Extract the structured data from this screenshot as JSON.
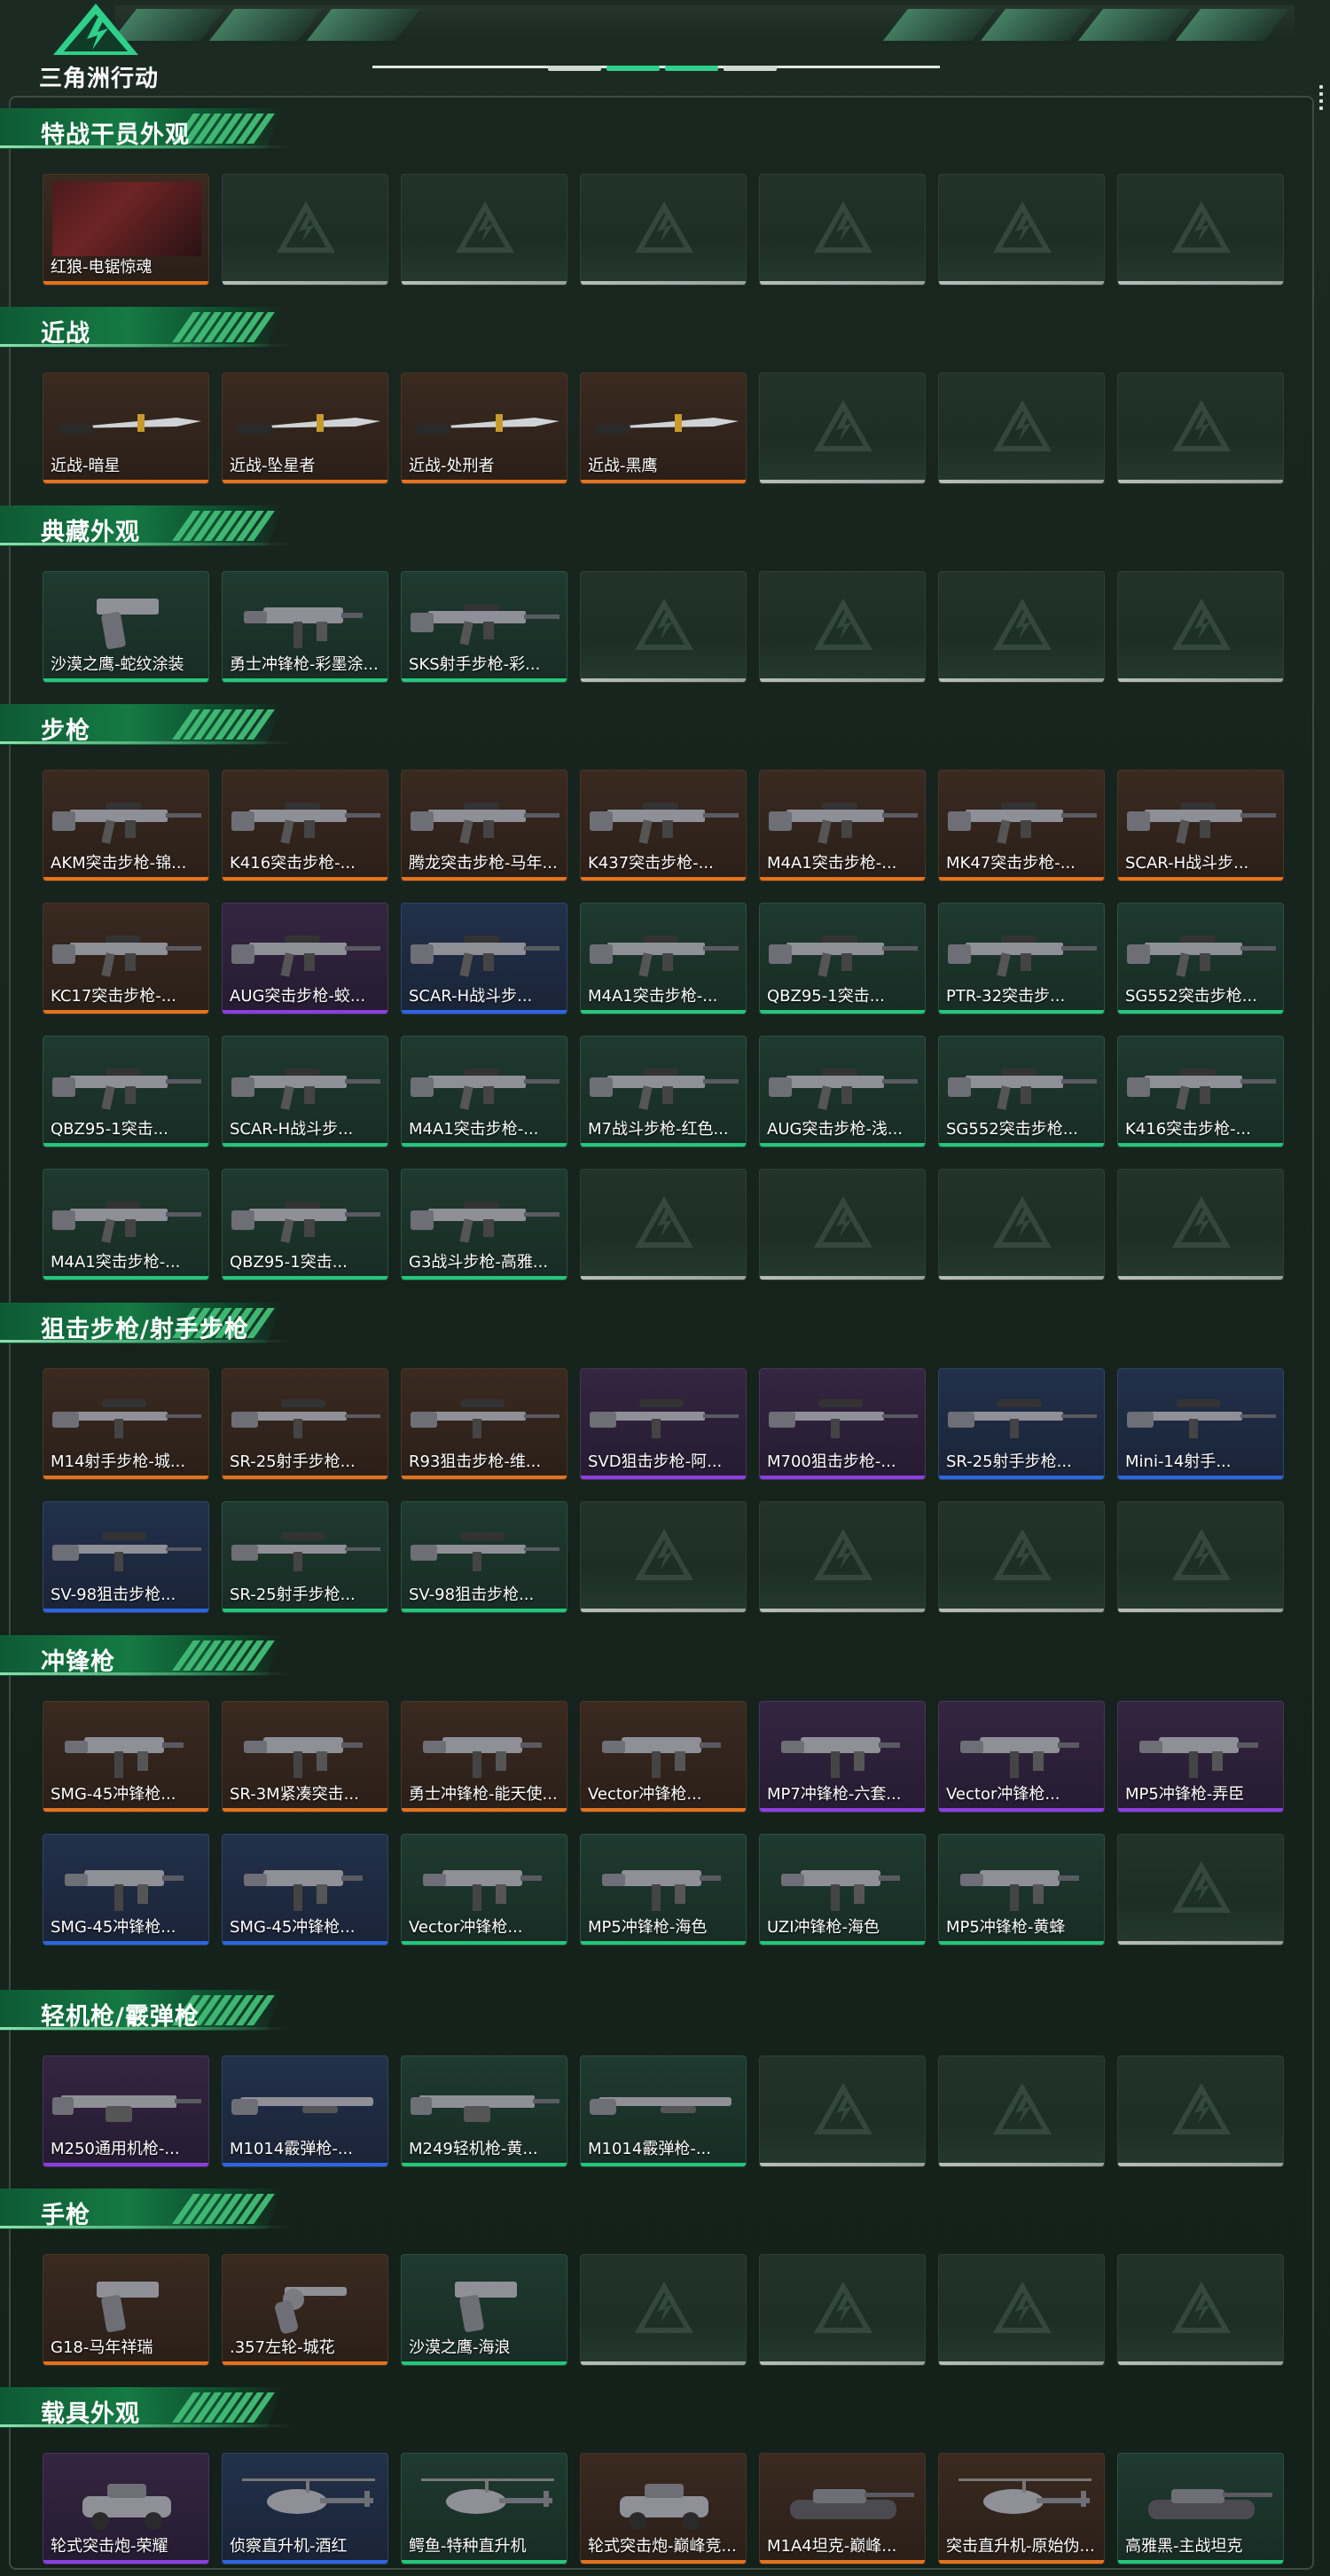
{
  "header": {
    "logo_text": "三角洲行动"
  },
  "sections": [
    {
      "title": "特战干员外观",
      "items": [
        {
          "name": "红狼-电锯惊魂",
          "rarity": "orange",
          "icon": "operator-portrait-icon"
        }
      ]
    },
    {
      "title": "近战",
      "items": [
        {
          "name": "近战-暗星",
          "rarity": "orange",
          "icon": "knife-icon"
        },
        {
          "name": "近战-坠星者",
          "rarity": "orange",
          "icon": "knife-icon"
        },
        {
          "name": "近战-处刑者",
          "rarity": "orange",
          "icon": "knife-icon"
        },
        {
          "name": "近战-黑鹰",
          "rarity": "orange",
          "icon": "knife-icon"
        }
      ]
    },
    {
      "title": "典藏外观",
      "items": [
        {
          "name": "沙漠之鹰-蛇纹涂装",
          "rarity": "green",
          "icon": "pistol-icon"
        },
        {
          "name": "勇士冲锋枪-彩墨涂...",
          "rarity": "green",
          "icon": "smg-icon"
        },
        {
          "name": "SKS射手步枪-彩...",
          "rarity": "green",
          "icon": "rifle-icon"
        }
      ]
    },
    {
      "title": "步枪",
      "items": [
        {
          "name": "AKM突击步枪-锦...",
          "rarity": "orange",
          "icon": "rifle-icon"
        },
        {
          "name": "K416突击步枪-...",
          "rarity": "orange",
          "icon": "rifle-icon"
        },
        {
          "name": "腾龙突击步枪-马年...",
          "rarity": "orange",
          "icon": "rifle-icon"
        },
        {
          "name": "K437突击步枪-...",
          "rarity": "orange",
          "icon": "rifle-icon"
        },
        {
          "name": "M4A1突击步枪-...",
          "rarity": "orange",
          "icon": "rifle-icon"
        },
        {
          "name": "MK47突击步枪-...",
          "rarity": "orange",
          "icon": "rifle-icon"
        },
        {
          "name": "SCAR-H战斗步...",
          "rarity": "orange",
          "icon": "rifle-icon"
        },
        {
          "name": "KC17突击步枪-...",
          "rarity": "orange",
          "icon": "rifle-icon"
        },
        {
          "name": "AUG突击步枪-蛟...",
          "rarity": "purple",
          "icon": "rifle-icon"
        },
        {
          "name": "SCAR-H战斗步...",
          "rarity": "blue",
          "icon": "rifle-icon"
        },
        {
          "name": "M4A1突击步枪-...",
          "rarity": "green",
          "icon": "rifle-icon"
        },
        {
          "name": "QBZ95-1突击...",
          "rarity": "green",
          "icon": "rifle-icon"
        },
        {
          "name": "PTR-32突击步...",
          "rarity": "green",
          "icon": "rifle-icon"
        },
        {
          "name": "SG552突击步枪...",
          "rarity": "green",
          "icon": "rifle-icon"
        },
        {
          "name": "QBZ95-1突击...",
          "rarity": "green",
          "icon": "rifle-icon"
        },
        {
          "name": "SCAR-H战斗步...",
          "rarity": "green",
          "icon": "rifle-icon"
        },
        {
          "name": "M4A1突击步枪-...",
          "rarity": "green",
          "icon": "rifle-icon"
        },
        {
          "name": "M7战斗步枪-红色...",
          "rarity": "green",
          "icon": "rifle-icon"
        },
        {
          "name": "AUG突击步枪-浅...",
          "rarity": "green",
          "icon": "rifle-icon"
        },
        {
          "name": "SG552突击步枪...",
          "rarity": "green",
          "icon": "rifle-icon"
        },
        {
          "name": "K416突击步枪-...",
          "rarity": "green",
          "icon": "rifle-icon"
        },
        {
          "name": "M4A1突击步枪-...",
          "rarity": "green",
          "icon": "rifle-icon"
        },
        {
          "name": "QBZ95-1突击...",
          "rarity": "green",
          "icon": "rifle-icon"
        },
        {
          "name": "G3战斗步枪-高雅...",
          "rarity": "green",
          "icon": "rifle-icon"
        }
      ]
    },
    {
      "title": "狙击步枪/射手步枪",
      "items": [
        {
          "name": "M14射手步枪-城...",
          "rarity": "orange",
          "icon": "sniper-icon"
        },
        {
          "name": "SR-25射手步枪...",
          "rarity": "orange",
          "icon": "sniper-icon"
        },
        {
          "name": "R93狙击步枪-维...",
          "rarity": "orange",
          "icon": "sniper-icon"
        },
        {
          "name": "SVD狙击步枪-阿...",
          "rarity": "purple",
          "icon": "sniper-icon"
        },
        {
          "name": "M700狙击步枪-...",
          "rarity": "purple",
          "icon": "sniper-icon"
        },
        {
          "name": "SR-25射手步枪...",
          "rarity": "blue",
          "icon": "sniper-icon"
        },
        {
          "name": "Mini-14射手...",
          "rarity": "blue",
          "icon": "sniper-icon"
        },
        {
          "name": "SV-98狙击步枪...",
          "rarity": "blue",
          "icon": "sniper-icon"
        },
        {
          "name": "SR-25射手步枪...",
          "rarity": "green",
          "icon": "sniper-icon"
        },
        {
          "name": "SV-98狙击步枪...",
          "rarity": "green",
          "icon": "sniper-icon"
        }
      ]
    },
    {
      "title": "冲锋枪",
      "items": [
        {
          "name": "SMG-45冲锋枪...",
          "rarity": "orange",
          "icon": "smg-icon"
        },
        {
          "name": "SR-3M紧凑突击...",
          "rarity": "orange",
          "icon": "smg-icon"
        },
        {
          "name": "勇士冲锋枪-能天使...",
          "rarity": "orange",
          "icon": "smg-icon"
        },
        {
          "name": "Vector冲锋枪...",
          "rarity": "orange",
          "icon": "smg-icon"
        },
        {
          "name": "MP7冲锋枪-六套...",
          "rarity": "purple",
          "icon": "smg-icon"
        },
        {
          "name": "Vector冲锋枪...",
          "rarity": "purple",
          "icon": "smg-icon"
        },
        {
          "name": "MP5冲锋枪-弄臣",
          "rarity": "purple",
          "icon": "smg-icon"
        },
        {
          "name": "SMG-45冲锋枪...",
          "rarity": "blue",
          "icon": "smg-icon"
        },
        {
          "name": "SMG-45冲锋枪...",
          "rarity": "blue",
          "icon": "smg-icon"
        },
        {
          "name": "Vector冲锋枪...",
          "rarity": "green",
          "icon": "smg-icon"
        },
        {
          "name": "MP5冲锋枪-海色",
          "rarity": "green",
          "icon": "smg-icon"
        },
        {
          "name": "UZI冲锋枪-海色",
          "rarity": "green",
          "icon": "smg-icon"
        },
        {
          "name": "MP5冲锋枪-黄蜂",
          "rarity": "green",
          "icon": "smg-icon"
        }
      ]
    },
    {
      "title": "轻机枪/霰弹枪",
      "items": [
        {
          "name": "M250通用机枪-...",
          "rarity": "purple",
          "icon": "lmg-icon"
        },
        {
          "name": "M1014霰弹枪-...",
          "rarity": "blue",
          "icon": "shotgun-icon"
        },
        {
          "name": "M249轻机枪-黄...",
          "rarity": "green",
          "icon": "lmg-icon"
        },
        {
          "name": "M1014霰弹枪-...",
          "rarity": "green",
          "icon": "shotgun-icon"
        }
      ]
    },
    {
      "title": "手枪",
      "items": [
        {
          "name": "G18-马年祥瑞",
          "rarity": "orange",
          "icon": "pistol-icon"
        },
        {
          "name": ".357左轮-城花",
          "rarity": "orange",
          "icon": "revolver-icon"
        },
        {
          "name": "沙漠之鹰-海浪",
          "rarity": "green",
          "icon": "pistol-icon"
        }
      ]
    },
    {
      "title": "载具外观",
      "items": [
        {
          "name": "轮式突击炮-荣耀",
          "rarity": "purple",
          "icon": "vehicle-icon"
        },
        {
          "name": "侦察直升机-酒红",
          "rarity": "blue",
          "icon": "helicopter-icon"
        },
        {
          "name": "鳄鱼-特种直升机",
          "rarity": "green",
          "icon": "helicopter-icon"
        },
        {
          "name": "轮式突击炮-巅峰竞...",
          "rarity": "orange",
          "icon": "vehicle-icon"
        },
        {
          "name": "M1A4坦克-巅峰...",
          "rarity": "orange",
          "icon": "tank-icon"
        },
        {
          "name": "突击直升机-原始伪...",
          "rarity": "orange",
          "icon": "helicopter-icon"
        },
        {
          "name": "高雅黑-主战坦克",
          "rarity": "green",
          "icon": "tank-icon"
        }
      ]
    }
  ],
  "colors": {
    "orange": "#e2731f",
    "purple": "#8a3fe0",
    "blue": "#2c66e0",
    "green": "#24c77a",
    "accent": "#1c8a4c"
  }
}
